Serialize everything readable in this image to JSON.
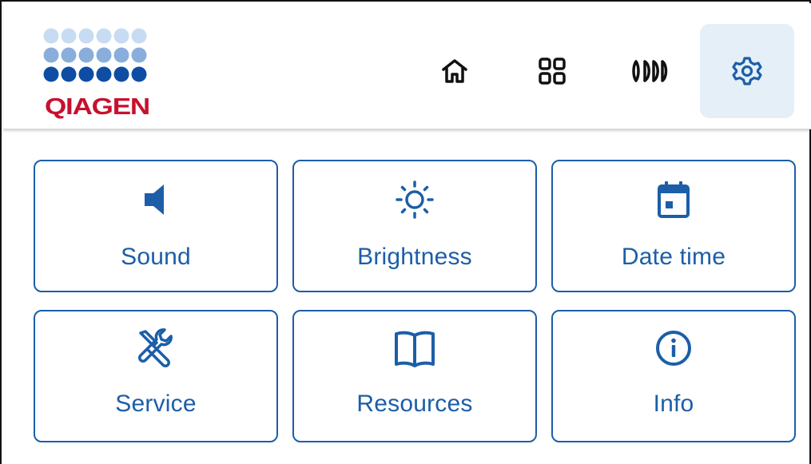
{
  "brand": {
    "name": "QIAGEN",
    "colors": {
      "accent": "#1c5ea8",
      "brand_red": "#c8102e",
      "dot_light": "#c7dcf2",
      "dot_mid": "#8aaedb",
      "dot_dark": "#0e4da4",
      "active_nav_bg": "#e4eff8"
    }
  },
  "header": {
    "nav": [
      {
        "id": "home",
        "icon": "home-icon",
        "active": false
      },
      {
        "id": "apps",
        "icon": "grid-icon",
        "active": false
      },
      {
        "id": "plates",
        "icon": "tubes-icon",
        "active": false
      },
      {
        "id": "settings",
        "icon": "gear-icon",
        "active": true
      }
    ]
  },
  "settings": {
    "tiles": [
      {
        "id": "sound",
        "label": "Sound",
        "icon": "speaker-icon"
      },
      {
        "id": "brightness",
        "label": "Brightness",
        "icon": "brightness-icon"
      },
      {
        "id": "datetime",
        "label": "Date time",
        "icon": "calendar-icon"
      },
      {
        "id": "service",
        "label": "Service",
        "icon": "tools-icon"
      },
      {
        "id": "resources",
        "label": "Resources",
        "icon": "book-icon"
      },
      {
        "id": "info",
        "label": "Info",
        "icon": "info-icon"
      }
    ]
  }
}
